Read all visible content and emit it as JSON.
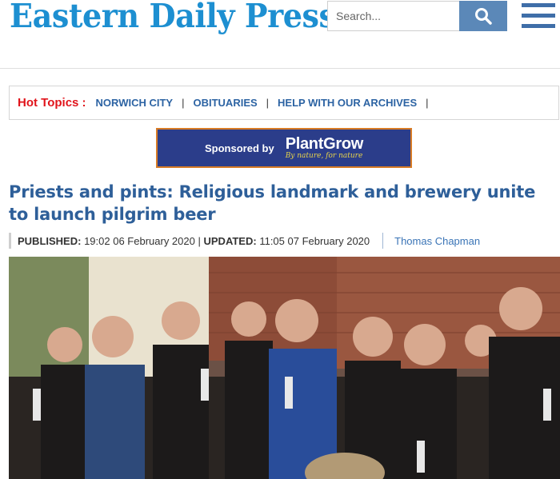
{
  "masthead": {
    "logo": "Eastern Daily Press",
    "search_placeholder": "Search...",
    "search_icon": "search-icon",
    "menu_icon": "hamburger-menu-icon"
  },
  "hot_topics": {
    "label": "Hot Topics :",
    "items": [
      "NORWICH CITY",
      "OBITUARIES",
      "HELP WITH OUR ARCHIVES"
    ],
    "separator": "|"
  },
  "sponsor": {
    "text": "Sponsored by",
    "brand": "PlantGrow",
    "tagline": "By nature, for nature"
  },
  "article": {
    "headline": "Priests and pints: Religious landmark and brewery unite to launch pilgrim beer",
    "published_label": "PUBLISHED:",
    "published_value": "19:02 06 February 2020",
    "meta_sep": "|",
    "updated_label": "UPDATED:",
    "updated_value": "11:05 07 February 2020",
    "author": "Thomas Chapman"
  },
  "colors": {
    "brand_blue": "#1d8fd1",
    "headline_blue": "#2e5f99",
    "link_blue": "#2c63a3",
    "hot_red": "#e1141b",
    "sponsor_bg": "#2b3d8a",
    "sponsor_border": "#d87c26"
  }
}
